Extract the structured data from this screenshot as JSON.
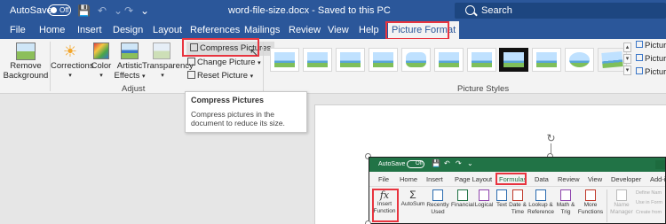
{
  "titlebar": {
    "autosave_label": "AutoSave",
    "autosave_state": "Off",
    "document_title": "word-file-size.docx  -  Saved to this PC",
    "search_placeholder": "Search",
    "bg_color": "#2b579a"
  },
  "tabs": [
    "File",
    "Home",
    "Insert",
    "Design",
    "Layout",
    "References",
    "Mailings",
    "Review",
    "View",
    "Help",
    "Picture Format"
  ],
  "active_tab": "Picture Format",
  "ribbon": {
    "remove_background": "Remove Background",
    "remove_background_l1": "Remove",
    "remove_background_l2": "Background",
    "corrections": "Corrections",
    "color": "Color",
    "artistic_effects_l1": "Artistic",
    "artistic_effects_l2": "Effects",
    "transparency": "Transparency",
    "compress_pictures": "Compress Pictures",
    "change_picture": "Change Picture",
    "reset_picture": "Reset Picture",
    "adjust_group": "Adjust",
    "picture_styles_group": "Picture Styles",
    "picture_right_1": "Pictur",
    "picture_right_2": "Pictur",
    "picture_right_3": "Pictur"
  },
  "tooltip": {
    "title": "Compress Pictures",
    "body": "Compress pictures in the document to reduce its size."
  },
  "excel": {
    "autosave_label": "AutoSave",
    "autosave_state": "Off",
    "tabs": [
      "File",
      "Home",
      "Insert",
      "Page Layout",
      "Formulas",
      "Data",
      "Review",
      "View",
      "Developer",
      "Add-in"
    ],
    "active_tab": "Formulas",
    "insert_function_l1": "Insert",
    "insert_function_l2": "Function",
    "fx": "fx",
    "autosum": "AutoSum",
    "recently_used_l1": "Recently",
    "recently_used_l2": "Used",
    "financial": "Financial",
    "logical": "Logical",
    "text": "Text",
    "date_time_l1": "Date &",
    "date_time_l2": "Time",
    "lookup_l1": "Lookup &",
    "lookup_l2": "Reference",
    "math_l1": "Math &",
    "math_l2": "Trig",
    "more_l1": "More",
    "more_l2": "Functions",
    "name_manager_l1": "Name",
    "name_manager_l2": "Manager",
    "define_name": "Define Nam",
    "use_in_formula": "Use in Form",
    "create_from": "Create from",
    "accent_color": "#217346"
  },
  "highlight_color": "#e8343f"
}
